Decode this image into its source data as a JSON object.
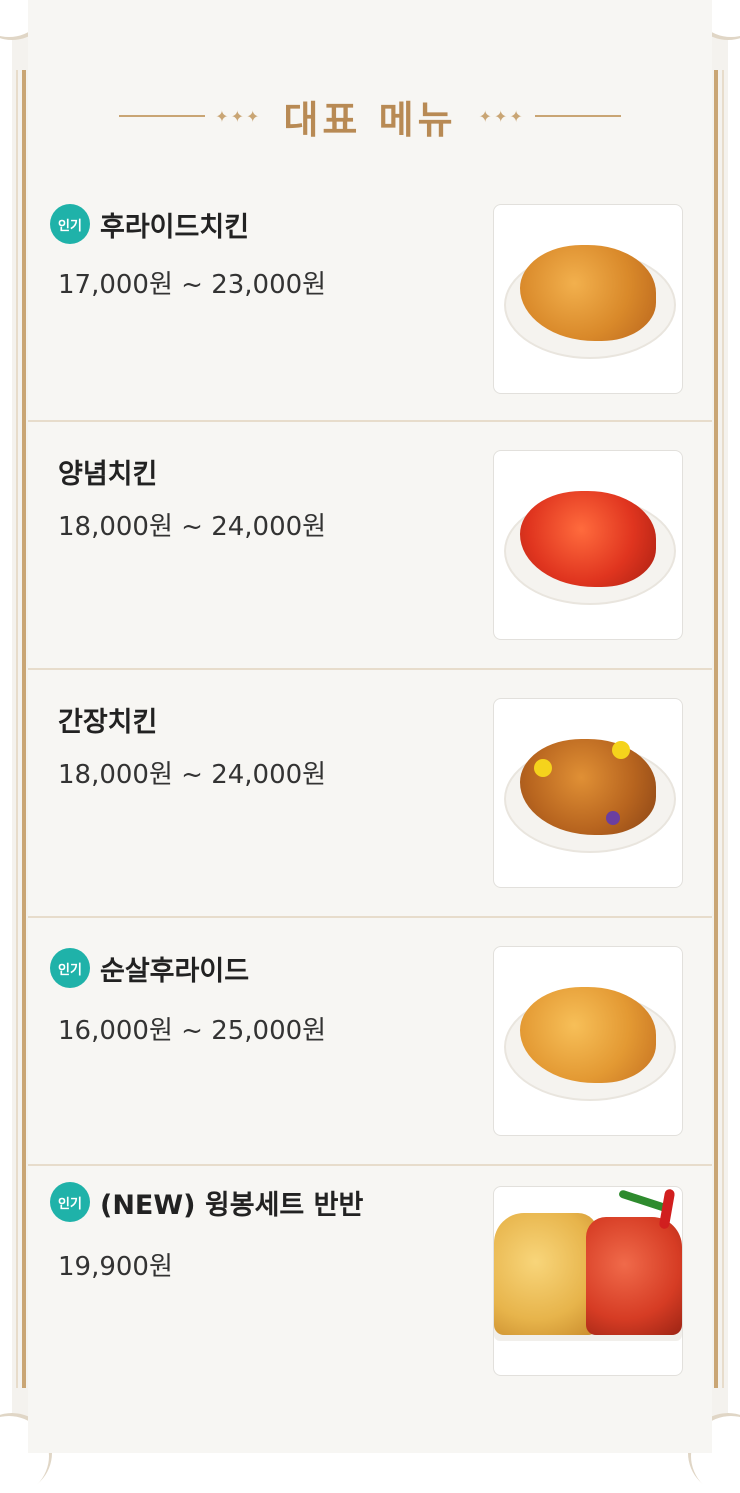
{
  "section": {
    "title": "대표 메뉴",
    "ornament": "✦✦✦"
  },
  "badge_label": "인기",
  "items": [
    {
      "name": "후라이드치킨",
      "price": "17,000원 ~ 23,000원",
      "popular": true,
      "image_icon": "fried-chicken-image"
    },
    {
      "name": "양념치킨",
      "price": "18,000원 ~ 24,000원",
      "popular": false,
      "image_icon": "yangnyeom-chicken-image"
    },
    {
      "name": "간장치킨",
      "price": "18,000원 ~ 24,000원",
      "popular": false,
      "image_icon": "soy-chicken-image"
    },
    {
      "name": "순살후라이드",
      "price": "16,000원 ~ 25,000원",
      "popular": true,
      "image_icon": "boneless-fried-chicken-image"
    },
    {
      "name": "(NEW) 윙봉세트 반반",
      "price": "19,900원",
      "popular": true,
      "image_icon": "wing-set-half-half-image"
    }
  ],
  "colors": {
    "accent_gold": "#c9a574",
    "title_gold": "#b88a54",
    "badge_teal": "#1fb2a9",
    "divider": "#e7dccb"
  }
}
